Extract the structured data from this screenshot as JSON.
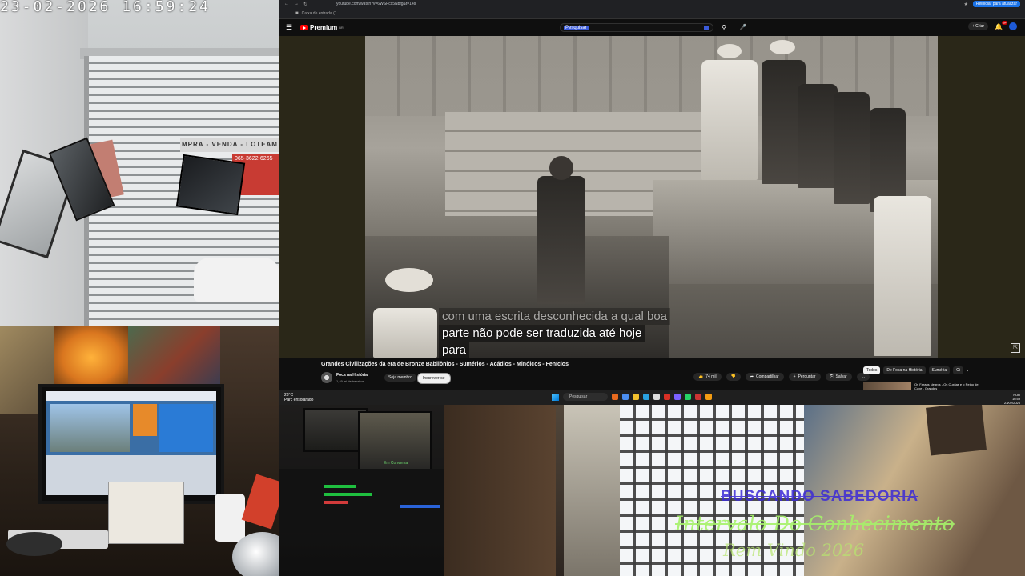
{
  "camera": {
    "timestamp": "23-02-2026  16:59:24",
    "sign_text": "MPRA - VENDA - LOTEAM",
    "sign_phone": "065-3622-6265"
  },
  "browser": {
    "url": "youtube.com/watch?v=6WSFcs5Nbfg&t=14s",
    "bookmark": "Caixa de entrada (1...",
    "update_button": "Reiniciar para atualizar"
  },
  "youtube": {
    "logo_text": "Premium",
    "logo_sup": "BR",
    "search_value": "Pesquisar",
    "create_label": "+ Criar",
    "notification_count": "9+",
    "subtitles": [
      "com uma escrita desconhecida a qual boa",
      "parte não pode ser traduzida até hoje",
      "para"
    ],
    "video_title": "Grandes Civilizações da era de Bronze Babilônios - Sumérios - Acádios - Minóicos - Fenícios",
    "channel_name": "Foca na História",
    "channel_subs": "1,49 mi de inscritos",
    "member_button": "Seja membro",
    "subscribe_button": "Inscrever-se",
    "actions": [
      {
        "icon": "like-icon",
        "label": "74 mil"
      },
      {
        "icon": "dislike-icon",
        "label": ""
      },
      {
        "icon": "share-icon",
        "label": "Compartilhar"
      },
      {
        "icon": "plus-icon",
        "label": "Perguntar"
      },
      {
        "icon": "save-icon",
        "label": "Salvar"
      },
      {
        "icon": "more-icon",
        "label": "..."
      }
    ],
    "chips": [
      "Todos",
      "De Foca na História",
      "Suméria",
      "Ci"
    ],
    "rec_title": "Os Faraós Negros - Os Cuxitas e o Reino de Cuxe - Grandes"
  },
  "taskbar": {
    "weather_temp": "28°C",
    "weather_desc": "Parc ensolarado",
    "search_placeholder": "Pesquisar",
    "language": "POR",
    "time": "16:59",
    "date": "23/02/2026"
  },
  "studio": {
    "overlay_text": "Em Conversa"
  },
  "overlay": {
    "title": "BUSCANDO SABEDORIA",
    "subtitle": "Intervalo Do Conhecimento",
    "year": "Rem Vindo 2026"
  }
}
